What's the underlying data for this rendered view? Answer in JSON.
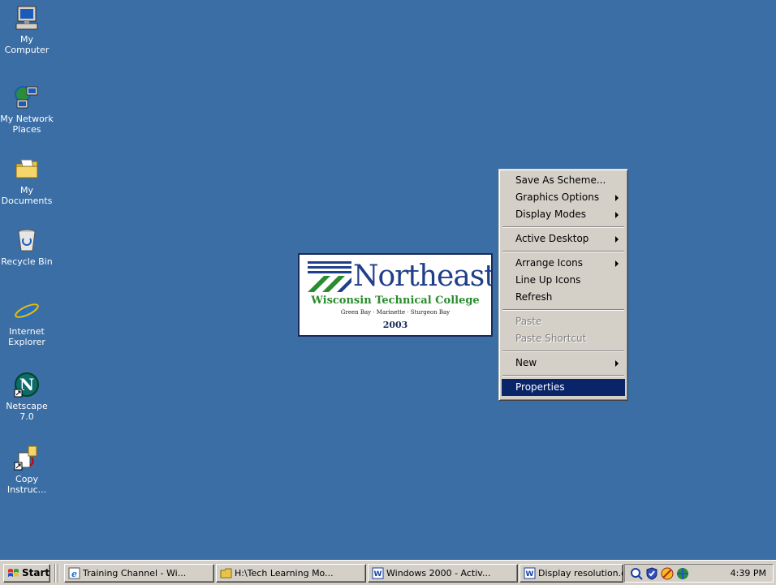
{
  "desktop": {
    "background": "#3a6ea5",
    "icons": [
      {
        "label": "My Computer",
        "icon": "computer-icon"
      },
      {
        "label": "My Network Places",
        "icon": "network-icon"
      },
      {
        "label": "My Documents",
        "icon": "folder-documents-icon"
      },
      {
        "label": "Recycle Bin",
        "icon": "recycle-bin-icon"
      },
      {
        "label": "Internet Explorer",
        "icon": "internet-explorer-icon"
      },
      {
        "label": "Netscape 7.0",
        "icon": "netscape-icon"
      },
      {
        "label": "Copy Instruc...",
        "icon": "copy-shortcut-icon"
      }
    ]
  },
  "logo": {
    "name": "Northeast",
    "college": "Wisconsin Technical College",
    "towns": "Green Bay · Marinette · Sturgeon Bay",
    "year": "2003"
  },
  "context_menu": {
    "items": [
      {
        "label": "Save As Scheme...",
        "submenu": false,
        "disabled": false
      },
      {
        "label": "Graphics Options",
        "submenu": true,
        "disabled": false
      },
      {
        "label": "Display Modes",
        "submenu": true,
        "disabled": false
      },
      {
        "separator": true
      },
      {
        "label": "Active Desktop",
        "submenu": true,
        "disabled": false
      },
      {
        "separator": true
      },
      {
        "label": "Arrange Icons",
        "submenu": true,
        "disabled": false
      },
      {
        "label": "Line Up Icons",
        "submenu": false,
        "disabled": false
      },
      {
        "label": "Refresh",
        "submenu": false,
        "disabled": false
      },
      {
        "separator": true
      },
      {
        "label": "Paste",
        "submenu": false,
        "disabled": true
      },
      {
        "label": "Paste Shortcut",
        "submenu": false,
        "disabled": true
      },
      {
        "separator": true
      },
      {
        "label": "New",
        "submenu": true,
        "disabled": false
      },
      {
        "separator": true
      },
      {
        "label": "Properties",
        "submenu": false,
        "disabled": false,
        "selected": true
      }
    ],
    "selected_color": "#0a246a"
  },
  "taskbar": {
    "start_label": "Start",
    "tasks": [
      {
        "label": "Training Channel - Wi...",
        "icon": "ie-page-icon"
      },
      {
        "label": "H:\\Tech Learning Mo...",
        "icon": "folder-icon"
      },
      {
        "label": "Windows 2000 - Activ...",
        "icon": "word-document-icon"
      },
      {
        "label": "Display resolution.do...",
        "icon": "word-document-icon"
      }
    ],
    "tray_icons": [
      "search-tray-icon",
      "shield-tray-icon",
      "antivirus-tray-icon",
      "network-tray-icon"
    ],
    "clock": "4:39 PM"
  }
}
